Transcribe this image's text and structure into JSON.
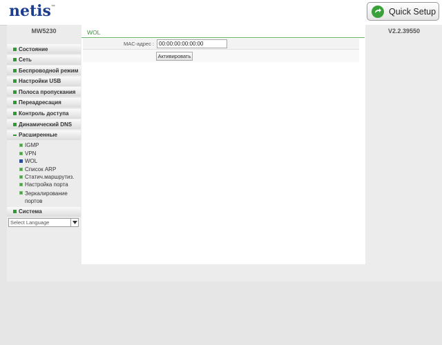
{
  "header": {
    "brand": "netis",
    "trademark": "™",
    "quick_setup_label": "Quick Setup"
  },
  "device": {
    "model": "MW5230",
    "firmware_version": "V2.2.39550"
  },
  "sidebar": {
    "items": [
      {
        "label": "Состояние"
      },
      {
        "label": "Сеть"
      },
      {
        "label": "Беспроводной режим"
      },
      {
        "label": "Настройки USB"
      },
      {
        "label": "Полоса пропускания"
      },
      {
        "label": "Переадресация"
      },
      {
        "label": "Контроль доступа"
      },
      {
        "label": "Динамический DNS"
      },
      {
        "label": "Расширенные",
        "expanded": true
      },
      {
        "label": "Система"
      }
    ],
    "subitems": [
      {
        "label": "IGMP"
      },
      {
        "label": "VPN"
      },
      {
        "label": "WOL",
        "active": true
      },
      {
        "label": "Список ARP"
      },
      {
        "label": "Статич.маршрутиз."
      },
      {
        "label": "Настройка порта"
      },
      {
        "label": "Зеркалирование портов"
      }
    ],
    "language_select": "Select Language"
  },
  "content": {
    "title": "WOL",
    "mac_label": "MAC-адрес :",
    "mac_value": "00:00:00:00:00:00",
    "activate_label": "Активировать"
  },
  "colors": {
    "accent_green": "#3d8f3c",
    "brand_blue": "#1d3e8c",
    "active_icon": "#2b4c9b"
  }
}
